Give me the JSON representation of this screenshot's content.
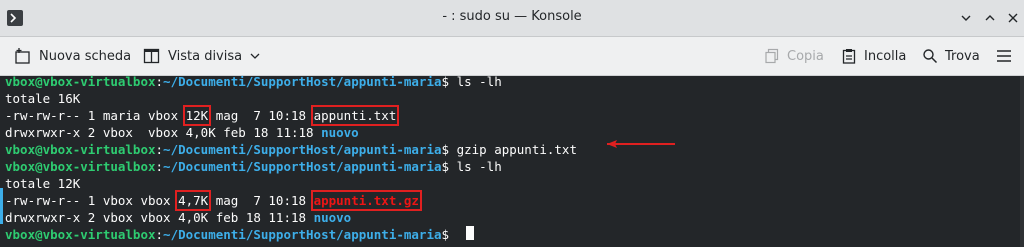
{
  "window": {
    "title": "- : sudo su — Konsole"
  },
  "toolbar": {
    "new_tab": "Nuova scheda",
    "split_view": "Vista divisa",
    "copy": "Copia",
    "paste": "Incolla",
    "find": "Trova"
  },
  "terminal": {
    "prompt_user": "vbox@vbox-virtualbox",
    "prompt_path": "~/Documenti/SupportHost/appunti-maria",
    "cmd1": "ls -lh",
    "total1": "totale 16K",
    "r1_pre": "-rw-rw-r-- 1 maria vbox ",
    "r1_size": "12K",
    "r1_mid": " mag  7 10:18 ",
    "r1_name": "appunti.txt",
    "r2_pre": "drwxrwxr-x 2 vbox  vbox 4,0K feb 18 11:18 ",
    "r2_name": "nuovo",
    "cmd2": "gzip appunti.txt",
    "cmd3": "ls -lh",
    "total2": "totale 12K",
    "r3_pre": "-rw-rw-r-- 1 vbox vbox ",
    "r3_size": "4,7K",
    "r3_mid": " mag  7 10:18 ",
    "r3_name": "appunti.txt.gz",
    "r4_pre": "drwxrwxr-x 2 vbox vbox 4,0K feb 18 11:18 ",
    "r4_name": "nuovo"
  }
}
